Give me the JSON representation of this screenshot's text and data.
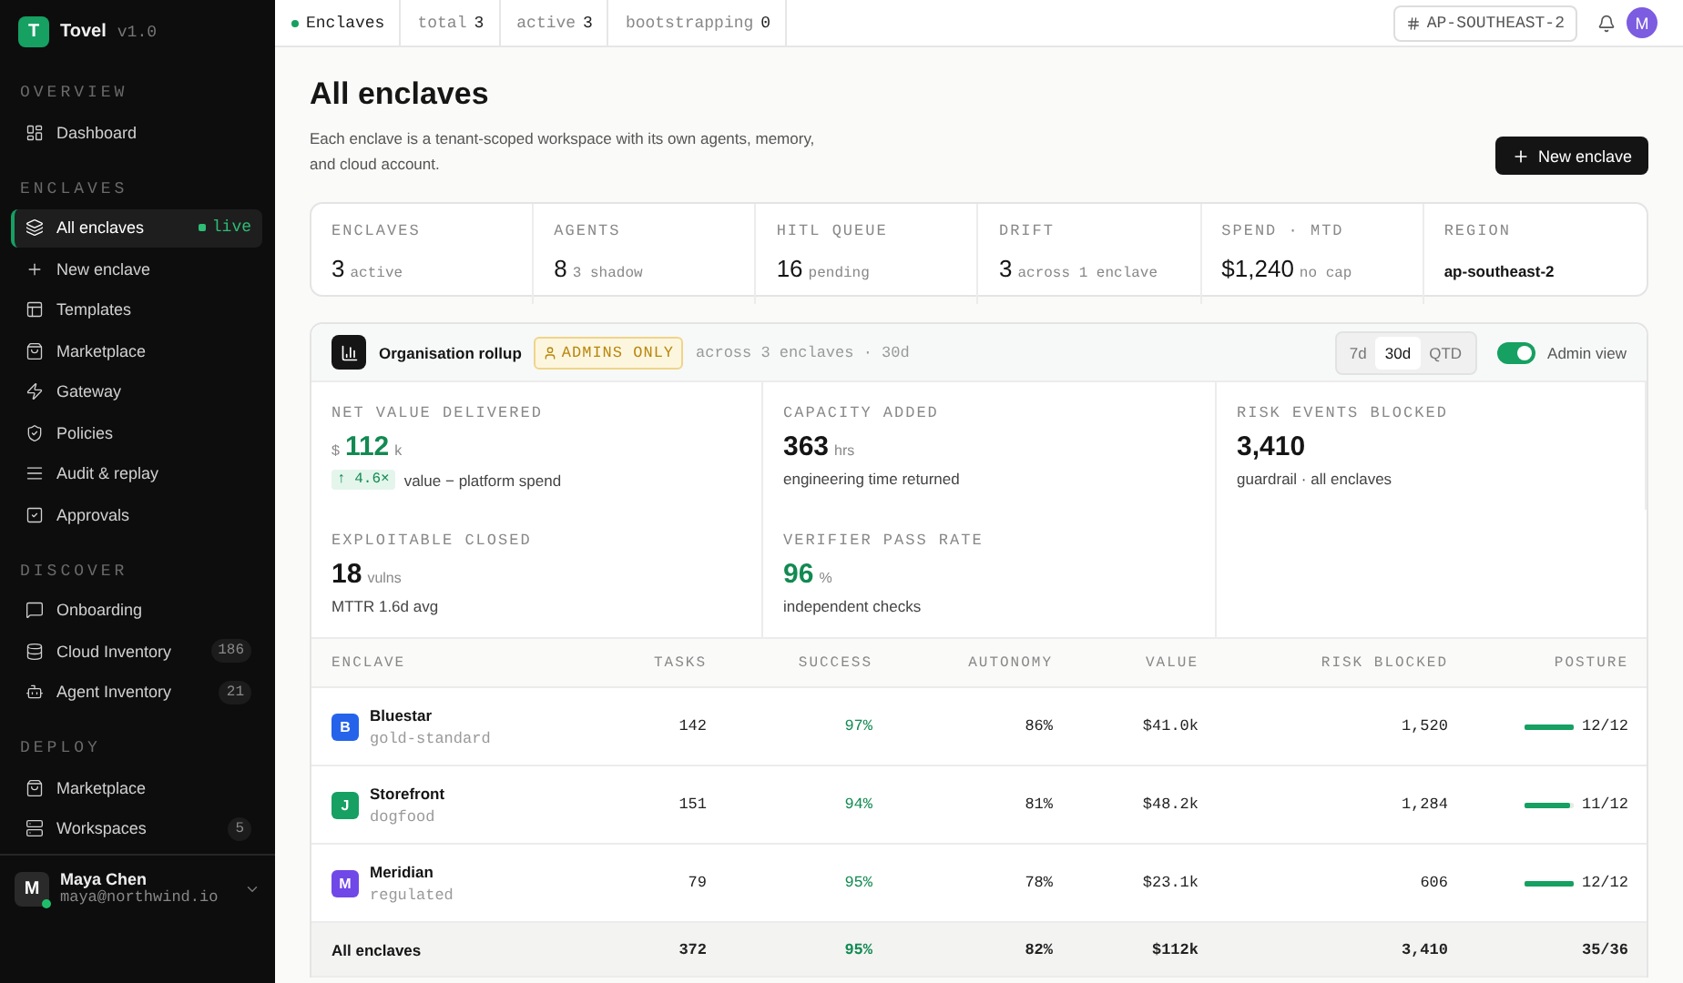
{
  "brand": {
    "logo": "T",
    "name": "Tovel",
    "version": "v1.0"
  },
  "sidebar": [
    {
      "heading": "OVERVIEW",
      "items": [
        {
          "label": "Dashboard",
          "selected": false
        }
      ]
    },
    {
      "heading": "ENCLAVES",
      "items": [
        {
          "label": "All enclaves",
          "selected": true,
          "badge": "live",
          "kind": "status"
        },
        {
          "label": "New enclave",
          "selected": false
        },
        {
          "label": "Templates",
          "selected": false
        },
        {
          "label": "Marketplace",
          "selected": false
        },
        {
          "label": "Gateway",
          "selected": false
        },
        {
          "label": "Policies",
          "selected": false
        },
        {
          "label": "Audit & replay",
          "selected": false
        },
        {
          "label": "Approvals",
          "selected": false
        }
      ]
    },
    {
      "heading": "DISCOVER",
      "items": [
        {
          "label": "Onboarding",
          "selected": false
        },
        {
          "label": "Cloud Inventory",
          "selected": false,
          "badge": "186",
          "kind": "count"
        },
        {
          "label": "Agent Inventory",
          "selected": false,
          "badge": "21",
          "kind": "count"
        }
      ]
    },
    {
      "heading": "DEPLOY",
      "items": [
        {
          "label": "Marketplace",
          "selected": false
        },
        {
          "label": "Workspaces",
          "selected": false,
          "badge": "5",
          "kind": "count"
        }
      ]
    }
  ],
  "user": {
    "initial": "M",
    "name": "Maya Chen",
    "email": "maya@northwind.io",
    "online": true
  },
  "topbar": {
    "section": "Enclaves",
    "stats": [
      {
        "label": "total",
        "value": "3"
      },
      {
        "label": "active",
        "value": "3"
      },
      {
        "label": "bootstrapping",
        "value": "0"
      }
    ],
    "region": "AP-SOUTHEAST-2",
    "avatar": "M"
  },
  "page": {
    "title": "All enclaves",
    "description": "Each enclave is a tenant-scoped workspace with its own agents, memory, and cloud account.",
    "action": "New enclave"
  },
  "summary": [
    {
      "label": "ENCLAVES",
      "value": "3",
      "note": "active"
    },
    {
      "label": "AGENTS",
      "value": "8",
      "note": "3 shadow"
    },
    {
      "label": "HITL QUEUE",
      "value": "16",
      "note": "pending"
    },
    {
      "label": "DRIFT",
      "value": "3",
      "note": "across 1 enclave"
    },
    {
      "label": "SPEND · MTD",
      "value": "$1,240",
      "note": "no cap"
    },
    {
      "label": "REGION",
      "value": "ap-southeast-2",
      "kind": "plain"
    }
  ],
  "rollup": {
    "title": "Organisation rollup",
    "badge": "ADMINS ONLY",
    "scope": "across 3 enclaves · 30d",
    "periods": [
      {
        "label": "7d",
        "selected": false
      },
      {
        "label": "30d",
        "selected": true
      },
      {
        "label": "QTD",
        "selected": false
      }
    ],
    "admin_view": {
      "label": "Admin view",
      "on": true
    },
    "metrics": [
      {
        "label": "NET VALUE DELIVERED",
        "prefix": "$",
        "value": "112",
        "unit": "k",
        "accent": true,
        "delta": "↑ 4.6×",
        "note": "value − platform spend"
      },
      {
        "label": "CAPACITY ADDED",
        "value": "363",
        "unit": "hrs",
        "accent": false,
        "note": "engineering time returned"
      },
      {
        "label": "RISK EVENTS BLOCKED",
        "value": "3,410",
        "accent": false,
        "note": "guardrail · all enclaves"
      },
      {
        "label": "EXPLOITABLE CLOSED",
        "value": "18",
        "unit": "vulns",
        "accent": false,
        "note": "MTTR 1.6d avg"
      },
      {
        "label": "VERIFIER PASS RATE",
        "value": "96",
        "unit": "%",
        "accent": true,
        "note": "independent checks"
      }
    ]
  },
  "table": {
    "columns": [
      "ENCLAVE",
      "TASKS",
      "SUCCESS",
      "AUTONOMY",
      "VALUE",
      "RISK BLOCKED",
      "POSTURE"
    ],
    "rows": [
      {
        "initial": "B",
        "color": "#2563eb",
        "name": "Bluestar",
        "tier": "gold-standard",
        "tasks": "142",
        "success": "97%",
        "autonomy": "86%",
        "value": "$41.0k",
        "risk": "1,520",
        "posture": "12/12",
        "level": 1
      },
      {
        "initial": "J",
        "color": "#16a062",
        "name": "Storefront",
        "tier": "dogfood",
        "tasks": "151",
        "success": "94%",
        "autonomy": "81%",
        "value": "$48.2k",
        "risk": "1,284",
        "posture": "11/12",
        "level": 0.917
      },
      {
        "initial": "M",
        "color": "#7048e8",
        "name": "Meridian",
        "tier": "regulated",
        "tasks": "79",
        "success": "95%",
        "autonomy": "78%",
        "value": "$23.1k",
        "risk": "606",
        "posture": "12/12",
        "level": 1
      }
    ],
    "total": {
      "name": "All enclaves",
      "tasks": "372",
      "success": "95%",
      "autonomy": "82%",
      "value": "$112k",
      "risk": "3,410",
      "posture": "35/36"
    }
  }
}
